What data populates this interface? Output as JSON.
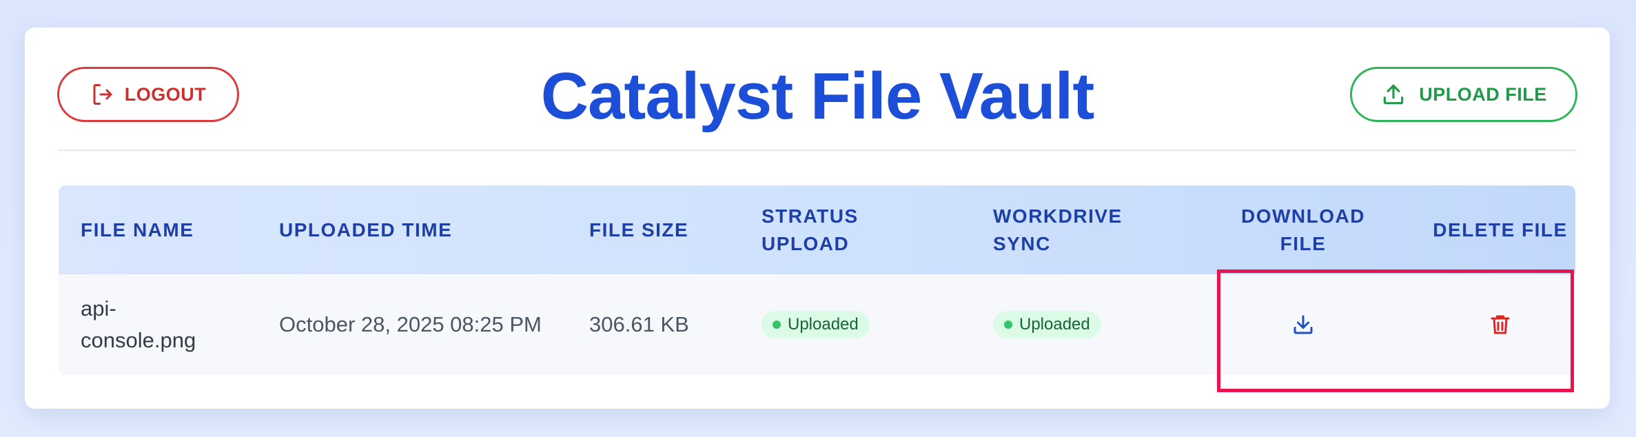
{
  "app": {
    "title": "Catalyst File Vault"
  },
  "header": {
    "logout_label": "LOGOUT",
    "upload_label": "UPLOAD FILE"
  },
  "table": {
    "columns": [
      "FILE NAME",
      "UPLOADED TIME",
      "FILE SIZE",
      "STRATUS UPLOAD",
      "WORKDRIVE SYNC",
      "DOWNLOAD FILE",
      "DELETE FILE"
    ],
    "rows": [
      {
        "file_name": "api-console.png",
        "uploaded_time": "October 28, 2025 08:25 PM",
        "file_size": "306.61 KB",
        "stratus_upload": "Uploaded",
        "workdrive_sync": "Uploaded"
      }
    ]
  },
  "icons": {
    "logout": "logout-icon",
    "upload": "upload-icon",
    "download": "download-icon",
    "delete": "trash-icon"
  },
  "colors": {
    "title": "#1d4ed8",
    "logout": "#cf2e2e",
    "upload": "#1f9a48",
    "header_text": "#1e3fa6",
    "badge_bg": "#dcfbe6",
    "badge_dot": "#34c46a",
    "highlight": "#e8134f"
  }
}
